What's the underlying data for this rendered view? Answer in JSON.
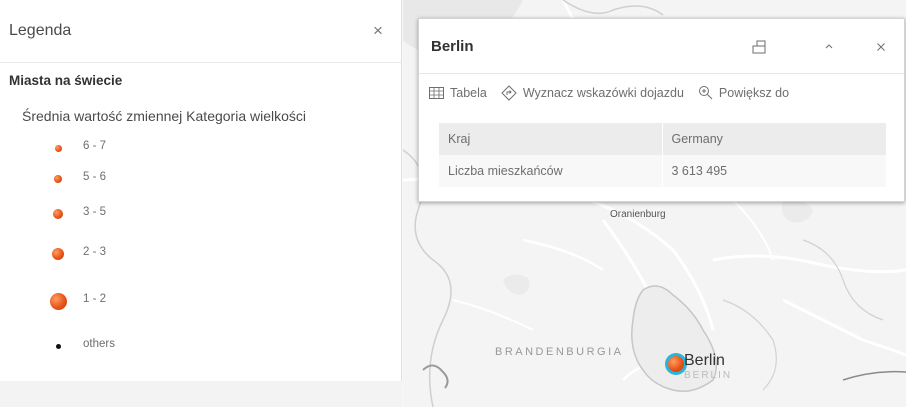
{
  "legend": {
    "title": "Legenda",
    "close_icon": "close-icon",
    "layer_name": "Miasta na świecie",
    "field_label": "Średnia wartość zmiennej Kategoria wielkości",
    "items": [
      {
        "label": "6 - 7",
        "symbol": "orange-dot"
      },
      {
        "label": "5 - 6",
        "symbol": "orange-dot"
      },
      {
        "label": "3 - 5",
        "symbol": "orange-dot"
      },
      {
        "label": "2 - 3",
        "symbol": "orange-dot"
      },
      {
        "label": "1 - 2",
        "symbol": "orange-dot"
      },
      {
        "label": "others",
        "symbol": "black-dot"
      }
    ]
  },
  "popup": {
    "title": "Berlin",
    "dock_icon": "dock-icon",
    "collapse_icon": "chevron-up-icon",
    "close_icon": "close-icon",
    "actions": [
      {
        "label": "Tabela",
        "icon": "table-icon"
      },
      {
        "label": "Wyznacz wskazówki dojazdu",
        "icon": "directions-icon"
      },
      {
        "label": "Powiększ do",
        "icon": "zoom-in-icon"
      }
    ],
    "rows": [
      {
        "field": "Kraj",
        "value": "Germany"
      },
      {
        "field": "Liczba mieszkańców",
        "value": "3 613 495"
      }
    ]
  },
  "map": {
    "labels": {
      "oranienburg": "Oranienburg",
      "brandenburgia": "BRANDENBURGIA",
      "berlin_city": "Berlin",
      "berlin_region": "BERLIN"
    },
    "highlight_color": "#28b5d9",
    "marker_color": "#e8541a"
  },
  "colors": {
    "accent_orange": "#e8541a",
    "map_background": "#f4f4f4"
  }
}
